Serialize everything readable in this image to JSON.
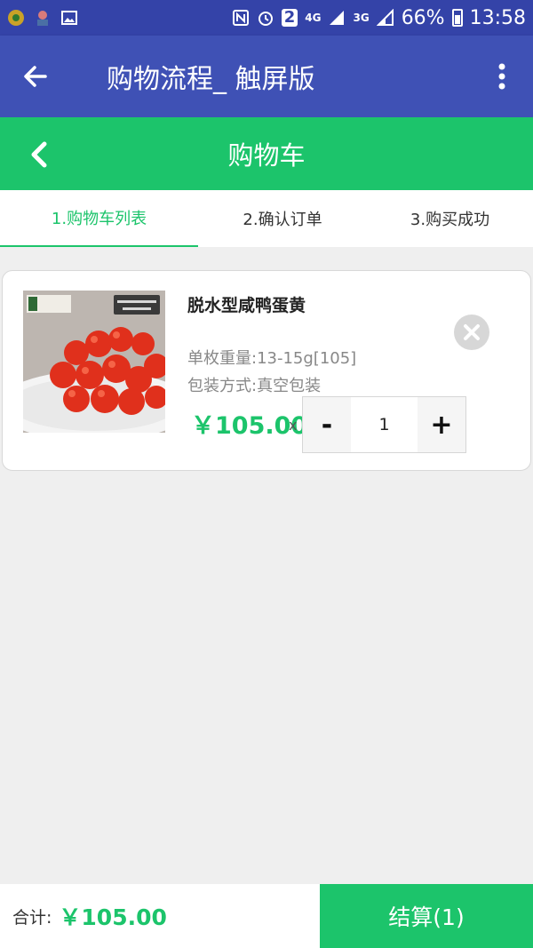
{
  "status_bar": {
    "network_4g": "4G",
    "network_3g": "3G",
    "sim_badge": "2",
    "battery": "66%",
    "time": "13:58"
  },
  "app_bar": {
    "title": "购物流程_ 触屏版"
  },
  "header": {
    "title": "购物车"
  },
  "steps": [
    {
      "label": "1.购物车列表",
      "active": true
    },
    {
      "label": "2.确认订单",
      "active": false
    },
    {
      "label": "3.购买成功",
      "active": false
    }
  ],
  "cart_item": {
    "name": "脱水型咸鸭蛋黄",
    "spec_weight": "单枚重量:13-15g[105]",
    "spec_pack": "包装方式:真空包装",
    "price": "￥105.00",
    "times": "x",
    "quantity": "1",
    "minus": "-",
    "plus": "+"
  },
  "footer": {
    "total_label": "合计:",
    "total_value": "￥105.00",
    "checkout_label": "结算(1)"
  },
  "colors": {
    "indigo": "#3f51b5",
    "status_indigo": "#3443a8",
    "green": "#1cc46b",
    "background": "#efefef"
  }
}
